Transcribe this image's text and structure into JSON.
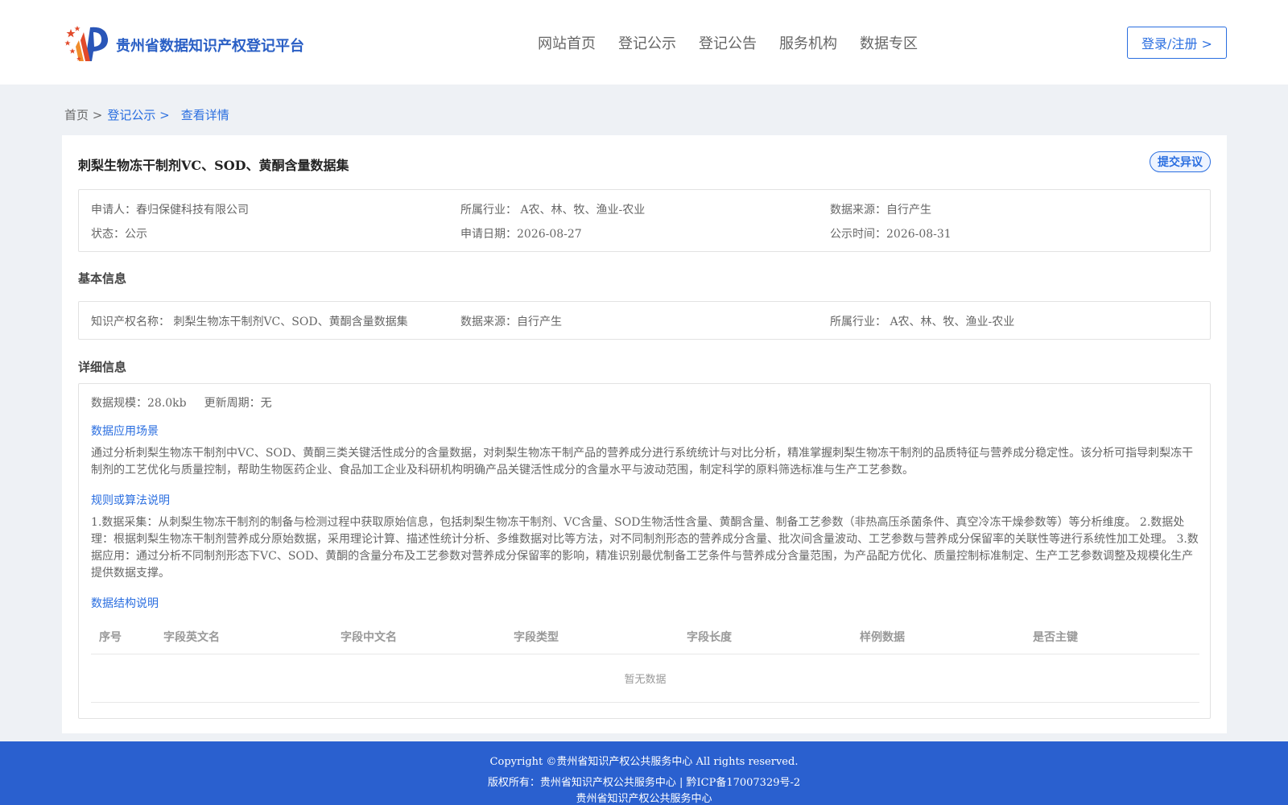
{
  "header": {
    "brand": "贵州省数据知识产权登记平台",
    "nav": [
      "网站首页",
      "登记公示",
      "登记公告",
      "服务机构",
      "数据专区"
    ],
    "login": "登录/注册 >"
  },
  "breadcrumb": [
    "首页 >",
    "登记公示 >",
    "查看详情"
  ],
  "record": {
    "title": "刺梨生物冻干制剂VC、SOD、黄酮含量数据集",
    "objection_button": "提交异议",
    "applicant": "申请人：春归保健科技有限公司",
    "industry": "所属行业： A农、林、牧、渔业-农业",
    "source": "数据来源：自行产生",
    "status": "状态：公示",
    "apply_date": "申请日期：2026-08-27",
    "publish_time": "公示时间：2026-08-31"
  },
  "basic": {
    "heading": "基本信息",
    "ip_name": "知识产权名称： 刺梨生物冻干制剂VC、SOD、黄酮含量数据集",
    "source": "数据来源：自行产生",
    "industry": "所属行业： A农、林、牧、渔业-农业"
  },
  "detail": {
    "heading": "详细信息",
    "scale": "数据规模：28.0kb",
    "cycle": "更新周期：无",
    "scenario_title": "数据应用场景",
    "scenario_text": "通过分析刺梨生物冻干制剂中VC、SOD、黄酮三类关键活性成分的含量数据，对刺梨生物冻干制产品的营养成分进行系统统计与对比分析，精准掌握刺梨生物冻干制剂的品质特征与营养成分稳定性。该分析可指导刺梨冻干制剂的工艺优化与质量控制，帮助生物医药企业、食品加工企业及科研机构明确产品关键活性成分的含量水平与波动范围，制定科学的原料筛选标准与生产工艺参数。",
    "algo_title": "规则或算法说明",
    "algo_text": "1.数据采集：从刺梨生物冻干制剂的制备与检测过程中获取原始信息，包括刺梨生物冻干制剂、VC含量、SOD生物活性含量、黄酮含量、制备工艺参数（非热高压杀菌条件、真空冷冻干燥参数等）等分析维度。 2.数据处理：根据刺梨生物冻干制剂营养成分原始数据，采用理论计算、描述性统计分析、多维数据对比等方法，对不同制剂形态的营养成分含量、批次间含量波动、工艺参数与营养成分保留率的关联性等进行系统性加工处理。 3.数据应用：通过分析不同制剂形态下VC、SOD、黄酮的含量分布及工艺参数对营养成分保留率的影响，精准识别最优制备工艺条件与营养成分含量范围，为产品配方优化、质量控制标准制定、生产工艺参数调整及规模化生产提供数据支撑。",
    "struct_title": "数据结构说明",
    "table_headers": [
      "序号",
      "字段英文名",
      "字段中文名",
      "字段类型",
      "字段长度",
      "样例数据",
      "是否主键"
    ],
    "empty_text": "暂无数据"
  },
  "footer": {
    "line1": "Copyright ©贵州省知识产权公共服务中心 All rights reserved.",
    "line2": "版权所有：贵州省知识产权公共服务中心 | 黔ICP备17007329号-2",
    "line3": "贵州省知识产权公共服务中心"
  },
  "colors": {
    "accent": "#2a6ee0",
    "footer_bg": "#2a60cf",
    "page_bg": "#eef1f5"
  }
}
